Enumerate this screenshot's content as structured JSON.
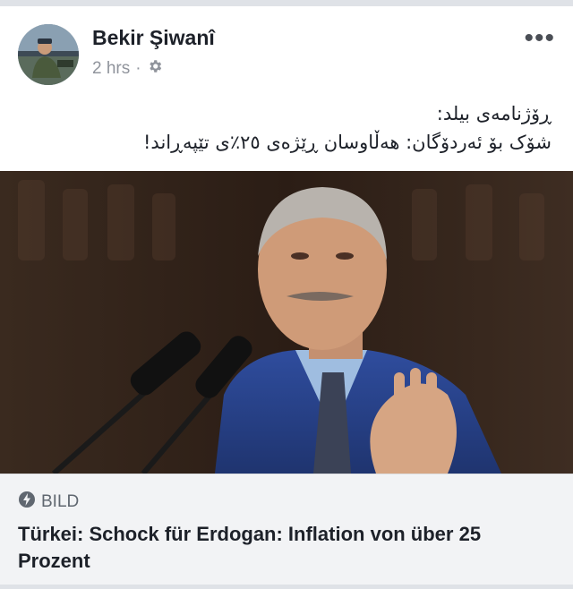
{
  "post": {
    "author": "Bekir Şiwanî",
    "time": "2 hrs",
    "separator": "·",
    "privacy_icon": "gear-icon",
    "more_icon": "more-icon",
    "text_line1": "ڕۆژنامەی بیلد:",
    "text_line2": "شۆک بۆ ئەردۆگان: هەڵاوسان ڕێژەی ٢٥٪ی تێپەڕاند!"
  },
  "link_preview": {
    "source_icon": "instant-article-bolt-icon",
    "source": "BILD",
    "headline": "Türkei: Schock für Erdogan: Inflation von über 25 Prozent"
  },
  "colors": {
    "name_text": "#1d2129",
    "meta_text": "#90949c",
    "preview_bg": "#f2f3f5"
  }
}
